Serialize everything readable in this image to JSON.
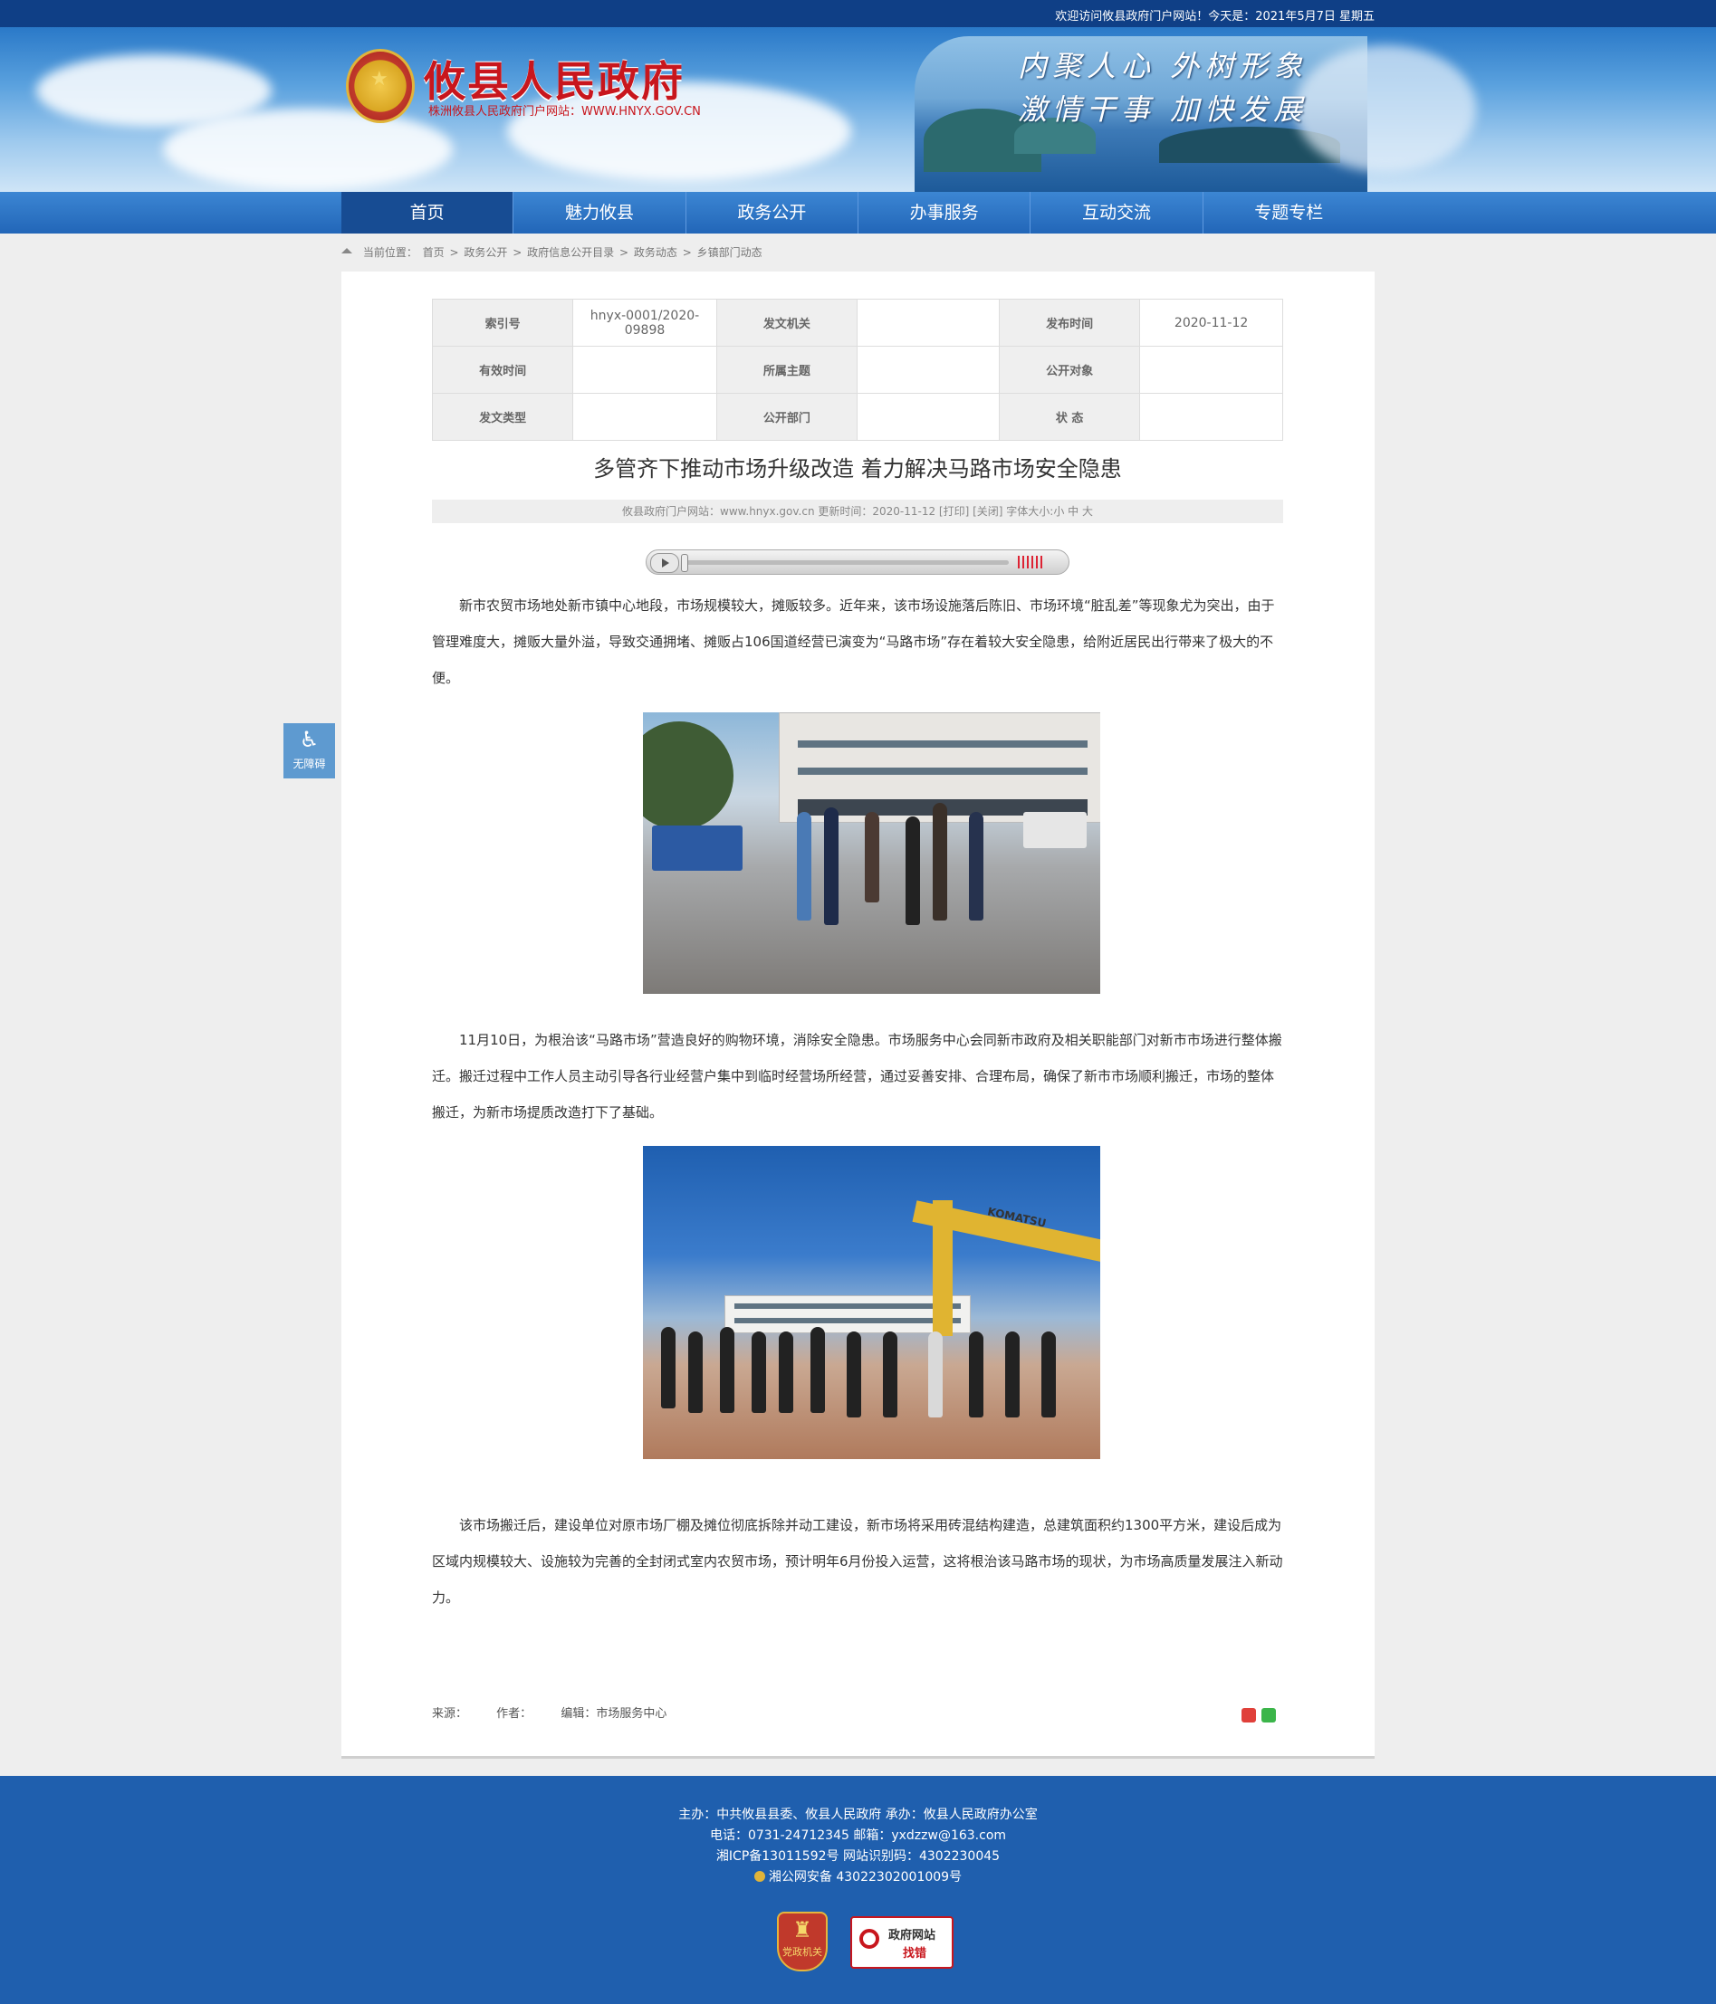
{
  "topbar": {
    "welcome": "欢迎访问攸县政府门户网站！今天是：2021年5月7日 星期五"
  },
  "header": {
    "site_title": "攸县人民政府",
    "site_sub": "株洲攸县人民政府门户网站：WWW.HNYX.GOV.CN",
    "slogan_line1": "内聚人心  外树形象",
    "slogan_line2": "激情干事  加快发展"
  },
  "nav": {
    "items": [
      {
        "label": "首页"
      },
      {
        "label": "魅力攸县"
      },
      {
        "label": "政务公开"
      },
      {
        "label": "办事服务"
      },
      {
        "label": "互动交流"
      },
      {
        "label": "专题专栏"
      }
    ]
  },
  "breadcrumb": {
    "prefix": "当前位置：",
    "items": [
      "首页",
      "政务公开",
      "政府信息公开目录",
      "政务动态",
      "乡镇部门动态"
    ],
    "sep": ">"
  },
  "meta": {
    "index_label": "索引号",
    "index_value": "hnyx-0001/2020-09898",
    "issuer_label": "发文机关",
    "issuer_value": "",
    "date_label": "发布时间",
    "date_value": "2020-11-12",
    "valid_label": "有效时间",
    "valid_value": "",
    "topic_label": "所属主题",
    "topic_value": "",
    "audience_label": "公开对象",
    "audience_value": "",
    "type_label": "发文类型",
    "type_value": "",
    "dept_label": "公开部门",
    "dept_value": "",
    "status_label": "状  态",
    "status_value": ""
  },
  "article": {
    "title": "多管齐下推动市场升级改造 着力解决马路市场安全隐患",
    "info": "攸县政府门户网站：www.hnyx.gov.cn   更新时间：2020-11-12   [打印] [关闭]   字体大小:小 中 大",
    "p1": "新市农贸市场地处新市镇中心地段，市场规模较大，摊贩较多。近年来，该市场设施落后陈旧、市场环境“脏乱差”等现象尤为突出，由于管理难度大，摊贩大量外溢，导致交通拥堵、摊贩占106国道经营已演变为“马路市场”存在着较大安全隐患，给附近居民出行带来了极大的不便。",
    "p2": "11月10日，为根治该“马路市场”营造良好的购物环境，消除安全隐患。市场服务中心会同新市政府及相关职能部门对新市市场进行整体搬迁。搬迁过程中工作人员主动引导各行业经营户集中到临时经营场所经营，通过妥善安排、合理布局，确保了新市市场顺利搬迁，市场的整体搬迁，为新市场提质改造打下了基础。",
    "p3": "该市场搬迁后，建设单位对原市场厂棚及摊位彻底拆除并动工建设，新市场将采用砖混结构建造，总建筑面积约1300平方米，建设后成为区域内规模较大、设施较为完善的全封闭式室内农贸市场，预计明年6月份投入运营，这将根治该马路市场的现状，为市场高质量发展注入新动力。",
    "excavator_brand": "KOMATSU",
    "source_label": "来源：",
    "author_label": "作者：",
    "editor_label": "编辑：市场服务中心"
  },
  "a11y": {
    "label": "无障碍",
    "icon": "wheelchair-icon"
  },
  "footer": {
    "line1": "主办：中共攸县县委、攸县人民政府 承办：攸县人民政府办公室",
    "line2": "电话：0731-24712345 邮箱：yxdzzw@163.com",
    "line3": "湘ICP备13011592号   网站识别码：4302230045",
    "line4": "湘公网安备 43022302001009号",
    "badge_party_label": "党政机关",
    "badge_find_line1": "政府网站",
    "badge_find_line2": "找错"
  },
  "colors": {
    "nav_blue": "#2266b8",
    "nav_active": "#174c93",
    "footer_blue": "#1f5fae",
    "title_red": "#c8161d"
  }
}
